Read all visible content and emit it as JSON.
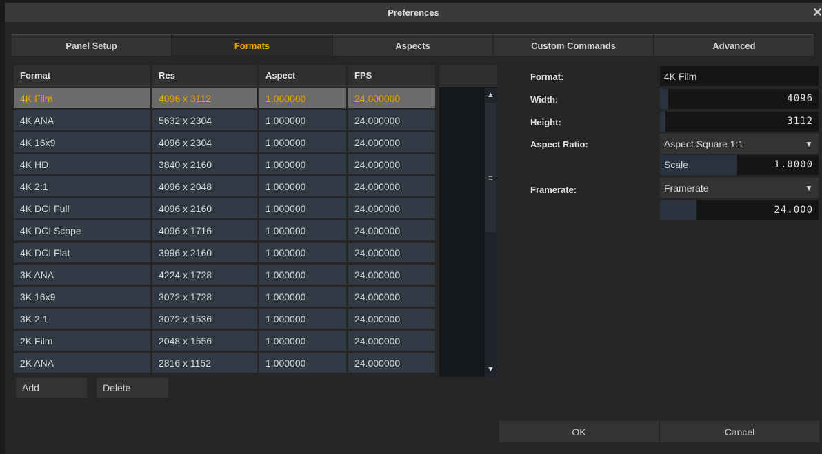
{
  "window": {
    "title": "Preferences",
    "close_glyph": "✕"
  },
  "tabs": [
    {
      "label": "Panel Setup",
      "active": false
    },
    {
      "label": "Formats",
      "active": true
    },
    {
      "label": "Aspects",
      "active": false
    },
    {
      "label": "Custom Commands",
      "active": false
    },
    {
      "label": "Advanced",
      "active": false
    }
  ],
  "table": {
    "columns": [
      "Format",
      "Res",
      "Aspect",
      "FPS"
    ],
    "rows": [
      [
        "4K Film",
        "4096 x 3112",
        "1.000000",
        "24.000000"
      ],
      [
        "4K ANA",
        "5632 x 2304",
        "1.000000",
        "24.000000"
      ],
      [
        "4K 16x9",
        "4096 x 2304",
        "1.000000",
        "24.000000"
      ],
      [
        "4K HD",
        "3840 x 2160",
        "1.000000",
        "24.000000"
      ],
      [
        "4K 2:1",
        "4096 x 2048",
        "1.000000",
        "24.000000"
      ],
      [
        "4K DCI Full",
        "4096 x 2160",
        "1.000000",
        "24.000000"
      ],
      [
        "4K DCI Scope",
        "4096 x 1716",
        "1.000000",
        "24.000000"
      ],
      [
        "4K DCI Flat",
        "3996 x 2160",
        "1.000000",
        "24.000000"
      ],
      [
        "3K ANA",
        "4224 x 1728",
        "1.000000",
        "24.000000"
      ],
      [
        "3K 16x9",
        "3072 x 1728",
        "1.000000",
        "24.000000"
      ],
      [
        "3K 2:1",
        "3072 x 1536",
        "1.000000",
        "24.000000"
      ],
      [
        "2K Film",
        "2048 x 1556",
        "1.000000",
        "24.000000"
      ],
      [
        "2K ANA",
        "2816 x 1152",
        "1.000000",
        "24.000000"
      ]
    ],
    "selected_row": 0
  },
  "list_buttons": {
    "add": "Add",
    "delete": "Delete"
  },
  "detail": {
    "format_label": "Format:",
    "format_value": "4K Film",
    "width_label": "Width:",
    "width_value": "4096",
    "height_label": "Height:",
    "height_value": "3112",
    "aspect_label": "Aspect Ratio:",
    "aspect_value": "Aspect Square 1:1",
    "scale_label": "Scale",
    "scale_value": "1.0000",
    "framerate_label": "Framerate:",
    "framerate_value": "Framerate",
    "framerate_number": "24.000"
  },
  "footer": {
    "ok": "OK",
    "cancel": "Cancel"
  },
  "colors": {
    "accent": "#f0a500",
    "row_bg": "#2f3a45",
    "selected_bg": "#6b6b6b"
  }
}
